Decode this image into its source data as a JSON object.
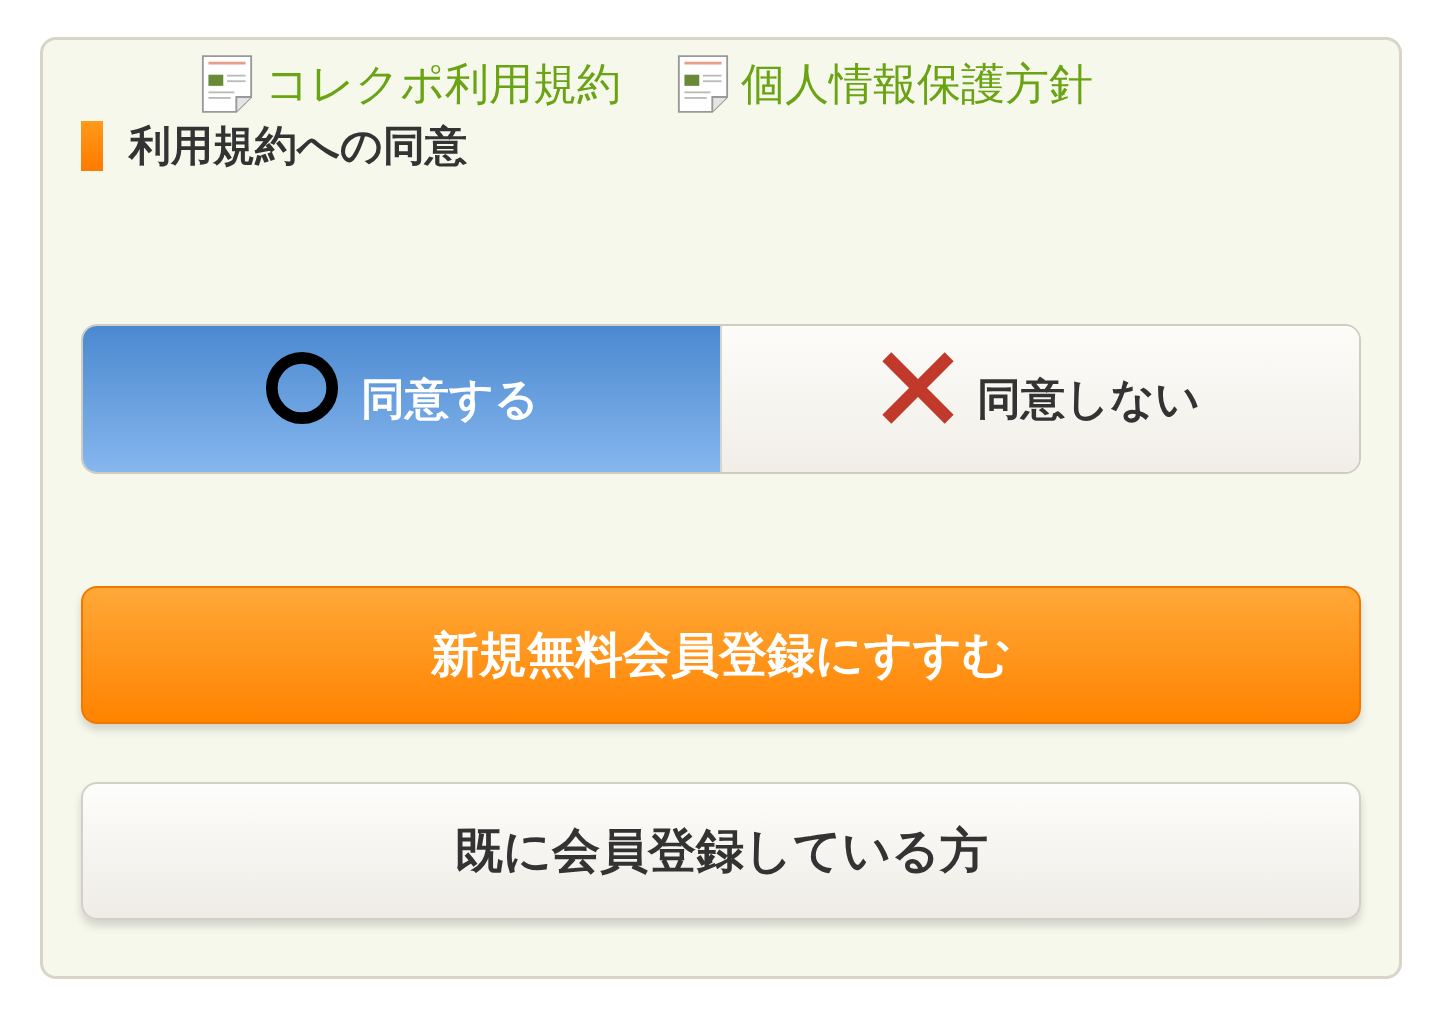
{
  "links": [
    {
      "label": "コレクポ利用規約"
    },
    {
      "label": "個人情報保護方針"
    }
  ],
  "heading": "利用規約への同意",
  "choices": [
    {
      "label": "同意する",
      "kind": "agree",
      "selected": true
    },
    {
      "label": "同意しない",
      "kind": "disagree",
      "selected": false
    }
  ],
  "buttons": [
    {
      "label": "新規無料会員登録にすすむ",
      "kind": "primary"
    },
    {
      "label": "既に会員登録している方",
      "kind": "secondary"
    }
  ]
}
